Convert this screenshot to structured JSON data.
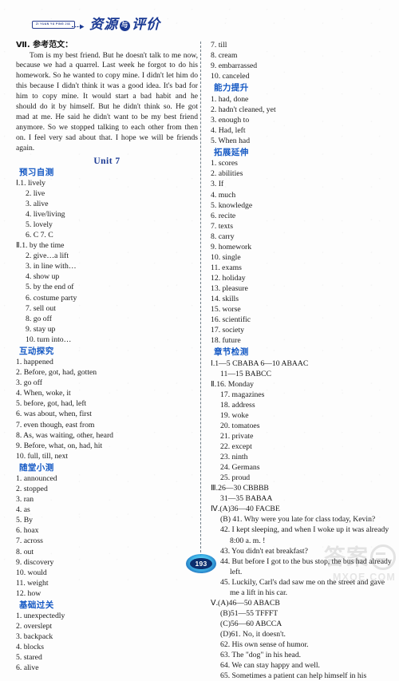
{
  "masthead": {
    "pinyin": "ZI YUAN YU PING JIA",
    "title_part1": "资源",
    "amp": "与",
    "title_part2": "评价"
  },
  "page_number": "193",
  "watermark": {
    "cn": "答案",
    "url": "MXQE.COM"
  },
  "left_column": {
    "essay_heading": "Ⅶ. 参考范文：",
    "essay_body": "Tom is my best friend. But he doesn't talk to me now, because we had a quarrel. Last week he forgot to do his homework. So he wanted to copy mine. I didn't let him do this because I didn't think it was a good idea. It's bad for him to copy mine. It would start a bad habit and he should do it by himself. But he didn't think so. He got mad at me. He said he didn't want to be my best friend anymore. So we stopped talking to each other from then on. I feel very sad about that. I hope we will be friends again.",
    "unit_title": "Unit 7",
    "sections": [
      {
        "heading": "预习自测",
        "items": [
          {
            "text": "Ⅰ.1. lively",
            "indent": 0
          },
          {
            "text": "2. live",
            "indent": 1
          },
          {
            "text": "3. alive",
            "indent": 1
          },
          {
            "text": "4. live/living",
            "indent": 1
          },
          {
            "text": "5. lovely",
            "indent": 1
          },
          {
            "text": "6. C   7. C",
            "indent": 1
          },
          {
            "text": "Ⅱ.1. by the time",
            "indent": 0
          },
          {
            "text": "2. give…a lift",
            "indent": 1
          },
          {
            "text": "3. in line with…",
            "indent": 1
          },
          {
            "text": "4. show up",
            "indent": 1
          },
          {
            "text": "5. by the end of",
            "indent": 1
          },
          {
            "text": "6. costume party",
            "indent": 1
          },
          {
            "text": "7. sell out",
            "indent": 1
          },
          {
            "text": "8. go off",
            "indent": 1
          },
          {
            "text": "9. stay up",
            "indent": 1
          },
          {
            "text": "10. turn into…",
            "indent": 1
          }
        ]
      },
      {
        "heading": "互动探究",
        "items": [
          {
            "text": "1. happened",
            "indent": 0
          },
          {
            "text": "2. Before, got, had, gotten",
            "indent": 0
          },
          {
            "text": "3. go off",
            "indent": 0
          },
          {
            "text": "4. When, woke, it",
            "indent": 0
          },
          {
            "text": "5. before, got, had, left",
            "indent": 0
          },
          {
            "text": "6. was about, when, first",
            "indent": 0
          },
          {
            "text": "7. even though, east from",
            "indent": 0
          },
          {
            "text": "8. As, was waiting, other, heard",
            "indent": 0
          },
          {
            "text": "9. Before, what, on, had, hit",
            "indent": 0
          },
          {
            "text": "10. full, till, next",
            "indent": 0
          }
        ]
      },
      {
        "heading": "随堂小测",
        "items": [
          {
            "text": "1. announced",
            "indent": 0
          },
          {
            "text": "2. stopped",
            "indent": 0
          },
          {
            "text": "3. ran",
            "indent": 0
          },
          {
            "text": "4. as",
            "indent": 0
          },
          {
            "text": "5. By",
            "indent": 0
          },
          {
            "text": "6. hoax",
            "indent": 0
          },
          {
            "text": "7. across",
            "indent": 0
          },
          {
            "text": "8. out",
            "indent": 0
          },
          {
            "text": "9. discovery",
            "indent": 0
          },
          {
            "text": "10. would",
            "indent": 0
          },
          {
            "text": "11. weight",
            "indent": 0
          },
          {
            "text": "12. how",
            "indent": 0
          }
        ]
      },
      {
        "heading": "基础过关",
        "items": [
          {
            "text": "1. unexpectedly",
            "indent": 0
          },
          {
            "text": "2. overslept",
            "indent": 0
          },
          {
            "text": "3. backpack",
            "indent": 0
          },
          {
            "text": "4. blocks",
            "indent": 0
          },
          {
            "text": "5. stared",
            "indent": 0
          },
          {
            "text": "6. alive",
            "indent": 0
          }
        ]
      }
    ]
  },
  "right_column": {
    "continued_items": [
      {
        "text": "7. till",
        "indent": 0
      },
      {
        "text": "8. cream",
        "indent": 0
      },
      {
        "text": "9. embarrassed",
        "indent": 0
      },
      {
        "text": "10. canceled",
        "indent": 0
      }
    ],
    "sections": [
      {
        "heading": "能力提升",
        "items": [
          {
            "text": "1. had, done",
            "indent": 0
          },
          {
            "text": "2. hadn't cleaned, yet",
            "indent": 0
          },
          {
            "text": "3. enough to",
            "indent": 0
          },
          {
            "text": "4. Had, left",
            "indent": 0
          },
          {
            "text": "5. When had",
            "indent": 0
          }
        ]
      },
      {
        "heading": "拓展延伸",
        "items": [
          {
            "text": "1. scores",
            "indent": 0
          },
          {
            "text": "2. abilities",
            "indent": 0
          },
          {
            "text": "3. If",
            "indent": 0
          },
          {
            "text": "4. much",
            "indent": 0
          },
          {
            "text": "5. knowledge",
            "indent": 0
          },
          {
            "text": "6. recite",
            "indent": 0
          },
          {
            "text": "7. texts",
            "indent": 0
          },
          {
            "text": "8. carry",
            "indent": 0
          },
          {
            "text": "9. homework",
            "indent": 0
          },
          {
            "text": "10. single",
            "indent": 0
          },
          {
            "text": "11. exams",
            "indent": 0
          },
          {
            "text": "12. holiday",
            "indent": 0
          },
          {
            "text": "13. pleasure",
            "indent": 0
          },
          {
            "text": "14. skills",
            "indent": 0
          },
          {
            "text": "15. worse",
            "indent": 0
          },
          {
            "text": "16. scientific",
            "indent": 0
          },
          {
            "text": "17. society",
            "indent": 0
          },
          {
            "text": "18. future",
            "indent": 0
          }
        ]
      },
      {
        "heading": "章节检测",
        "items": [
          {
            "text": "Ⅰ.1—5   CBABA   6—10   ABAAC",
            "indent": 0
          },
          {
            "text": "11—15   BABCC",
            "indent": 1
          },
          {
            "text": "Ⅱ.16. Monday",
            "indent": 0
          },
          {
            "text": "17. magazines",
            "indent": 1
          },
          {
            "text": "18. address",
            "indent": 1
          },
          {
            "text": "19. woke",
            "indent": 1
          },
          {
            "text": "20. tomatoes",
            "indent": 1
          },
          {
            "text": "21. private",
            "indent": 1
          },
          {
            "text": "22. except",
            "indent": 1
          },
          {
            "text": "23. ninth",
            "indent": 1
          },
          {
            "text": "24. Germans",
            "indent": 1
          },
          {
            "text": "25. proud",
            "indent": 1
          },
          {
            "text": "Ⅲ.26—30   CBBBB",
            "indent": 0
          },
          {
            "text": "31—35   BABAA",
            "indent": 1
          },
          {
            "text": "Ⅳ.(A)36—40   FACBE",
            "indent": 0
          }
        ]
      }
    ],
    "dialogue": [
      "(B) 41. Why were you late for class today, Kevin?",
      "42. I kept sleeping, and when I woke up it was already 8:00 a. m. !",
      "43. You didn't eat breakfast?",
      "44. But before I got to the bus stop, the bus had already left.",
      "45. Luckily, Carl's dad saw me on the street and gave me a lift in his car."
    ],
    "final_section": [
      {
        "text": "Ⅴ.(A)46—50   ABACB",
        "indent": 0
      },
      {
        "text": "(B)51—55   TFFFT",
        "indent": 1
      },
      {
        "text": "(C)56—60   ABCCA",
        "indent": 1
      },
      {
        "text": "(D)61. No, it doesn't.",
        "indent": 1
      },
      {
        "text": "62. His own sense of humor.",
        "indent": 1
      },
      {
        "text": "63. The \"dog\" in his head.",
        "indent": 1
      },
      {
        "text": "64. We can stay happy and well.",
        "indent": 1
      }
    ],
    "last_line": "65. Sometimes a patient can help himself in his"
  }
}
